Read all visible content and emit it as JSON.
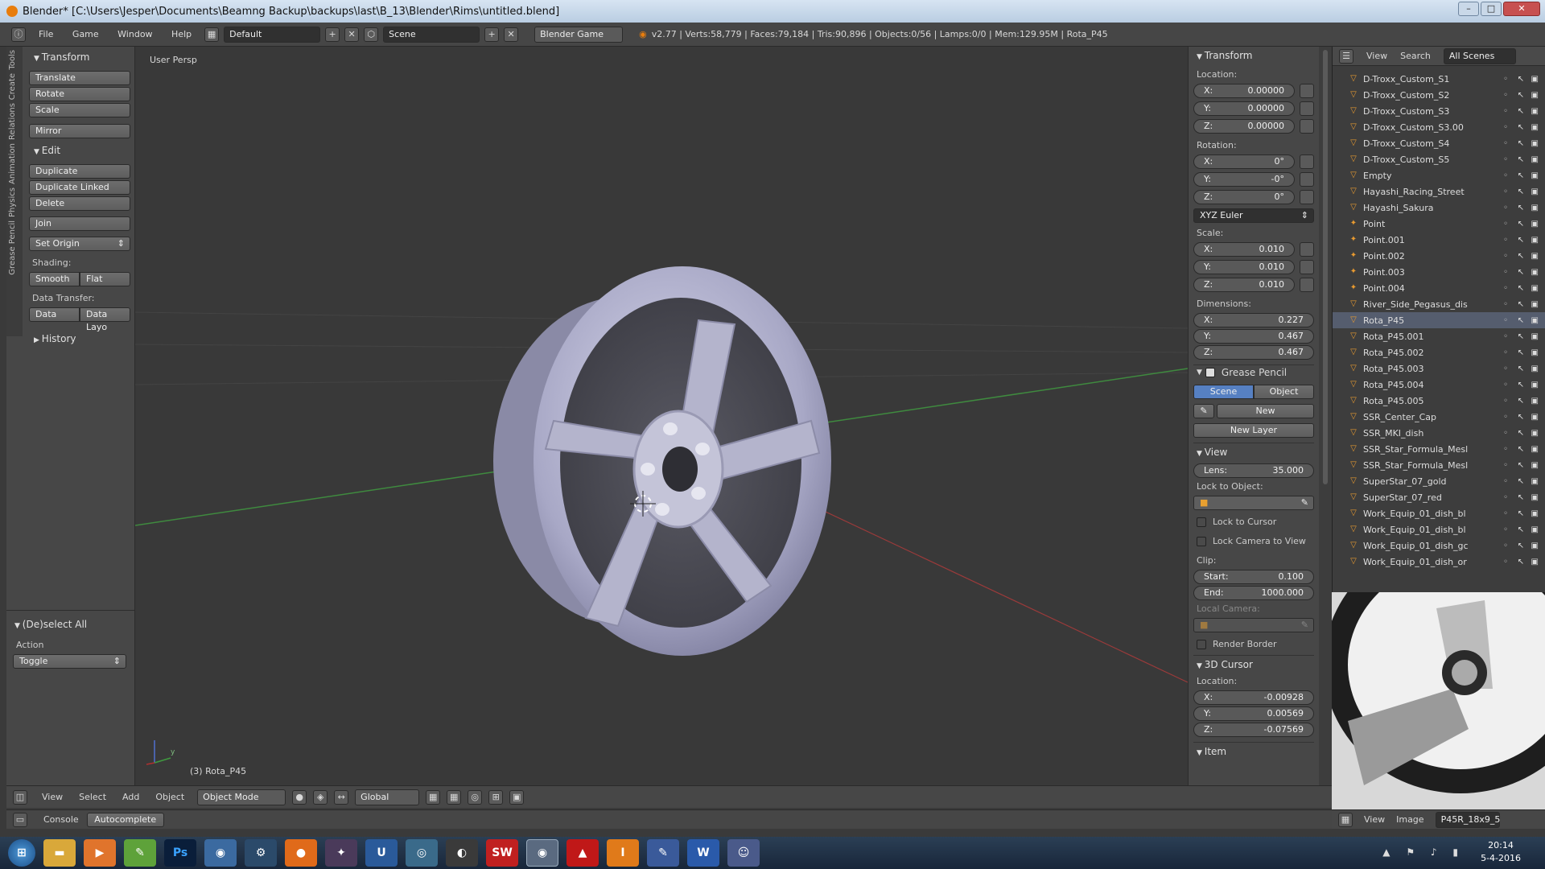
{
  "window": {
    "title": "Blender* [C:\\Users\\Jesper\\Documents\\Beamng Backup\\backups\\last\\B_13\\Blender\\Rims\\untitled.blend]"
  },
  "info_header": {
    "menus": [
      "File",
      "Game",
      "Window",
      "Help"
    ],
    "layout": "Default",
    "scene": "Scene",
    "engine": "Blender Game",
    "stats": "v2.77 | Verts:58,779 | Faces:79,184 | Tris:90,896 | Objects:0/56 | Lamps:0/0 | Mem:129.95M | Rota_P45"
  },
  "tool_shelf": {
    "tabs": [
      "Tools",
      "Create",
      "Relations",
      "Animation",
      "Physics",
      "Grease Pencil"
    ],
    "transform": {
      "title": "Transform",
      "translate": "Translate",
      "rotate": "Rotate",
      "scale": "Scale",
      "mirror": "Mirror"
    },
    "edit": {
      "title": "Edit",
      "duplicate": "Duplicate",
      "duplicate_linked": "Duplicate Linked",
      "delete": "Delete",
      "join": "Join",
      "set_origin": "Set Origin",
      "shading_label": "Shading:",
      "smooth": "Smooth",
      "flat": "Flat",
      "data_transfer_label": "Data Transfer:",
      "data": "Data",
      "data_layout": "Data Layo"
    },
    "history": "History",
    "operator": {
      "title": "(De)select All",
      "action_label": "Action",
      "action_value": "Toggle"
    }
  },
  "viewport": {
    "view_label": "User Persp",
    "object_label": "(3) Rota_P45",
    "axis_y": "y"
  },
  "properties": {
    "transform_title": "Transform",
    "location_label": "Location:",
    "location": [
      {
        "axis": "X:",
        "value": "0.00000"
      },
      {
        "axis": "Y:",
        "value": "0.00000"
      },
      {
        "axis": "Z:",
        "value": "0.00000"
      }
    ],
    "rotation_label": "Rotation:",
    "rotation": [
      {
        "axis": "X:",
        "value": "0°"
      },
      {
        "axis": "Y:",
        "value": "-0°"
      },
      {
        "axis": "Z:",
        "value": "0°"
      }
    ],
    "rotation_mode": "XYZ Euler",
    "scale_label": "Scale:",
    "scale": [
      {
        "axis": "X:",
        "value": "0.010"
      },
      {
        "axis": "Y:",
        "value": "0.010"
      },
      {
        "axis": "Z:",
        "value": "0.010"
      }
    ],
    "dimensions_label": "Dimensions:",
    "dimensions": [
      {
        "axis": "X:",
        "value": "0.227"
      },
      {
        "axis": "Y:",
        "value": "0.467"
      },
      {
        "axis": "Z:",
        "value": "0.467"
      }
    ],
    "grease_pencil": {
      "title": "Grease Pencil",
      "scene": "Scene",
      "object": "Object",
      "new": "New",
      "new_layer": "New Layer"
    },
    "view": {
      "title": "View",
      "lens_label": "Lens:",
      "lens_value": "35.000",
      "lock_to_object": "Lock to Object:",
      "lock_to_cursor": "Lock to Cursor",
      "lock_camera": "Lock Camera to View",
      "clip_label": "Clip:",
      "start_label": "Start:",
      "start_value": "0.100",
      "end_label": "End:",
      "end_value": "1000.000",
      "local_camera": "Local Camera:",
      "render_border": "Render Border"
    },
    "cursor": {
      "title": "3D Cursor",
      "location_label": "Location:",
      "x": "-0.00928",
      "y": "0.00569",
      "z": "-0.07569"
    },
    "item_title": "Item"
  },
  "outliner": {
    "header": {
      "view": "View",
      "search": "Search",
      "filter": "All Scenes"
    },
    "items": [
      {
        "name": "D-Troxx_Custom_S1",
        "icon": "▽"
      },
      {
        "name": "D-Troxx_Custom_S2",
        "icon": "▽"
      },
      {
        "name": "D-Troxx_Custom_S3",
        "icon": "▽"
      },
      {
        "name": "D-Troxx_Custom_S3.00",
        "icon": "▽"
      },
      {
        "name": "D-Troxx_Custom_S4",
        "icon": "▽"
      },
      {
        "name": "D-Troxx_Custom_S5",
        "icon": "▽"
      },
      {
        "name": "Empty",
        "icon": "▽"
      },
      {
        "name": "Hayashi_Racing_Street",
        "icon": "▽"
      },
      {
        "name": "Hayashi_Sakura",
        "icon": "▽"
      },
      {
        "name": "Point",
        "icon": "✦"
      },
      {
        "name": "Point.001",
        "icon": "✦"
      },
      {
        "name": "Point.002",
        "icon": "✦"
      },
      {
        "name": "Point.003",
        "icon": "✦"
      },
      {
        "name": "Point.004",
        "icon": "✦"
      },
      {
        "name": "River_Side_Pegasus_dis",
        "icon": "▽"
      },
      {
        "name": "Rota_P45",
        "icon": "▽"
      },
      {
        "name": "Rota_P45.001",
        "icon": "▽"
      },
      {
        "name": "Rota_P45.002",
        "icon": "▽"
      },
      {
        "name": "Rota_P45.003",
        "icon": "▽"
      },
      {
        "name": "Rota_P45.004",
        "icon": "▽"
      },
      {
        "name": "Rota_P45.005",
        "icon": "▽"
      },
      {
        "name": "SSR_Center_Cap",
        "icon": "▽"
      },
      {
        "name": "SSR_MKI_dish",
        "icon": "▽"
      },
      {
        "name": "SSR_Star_Formula_Mesl",
        "icon": "▽"
      },
      {
        "name": "SSR_Star_Formula_Mesl",
        "icon": "▽"
      },
      {
        "name": "SuperStar_07_gold",
        "icon": "▽"
      },
      {
        "name": "SuperStar_07_red",
        "icon": "▽"
      },
      {
        "name": "Work_Equip_01_dish_bl",
        "icon": "▽"
      },
      {
        "name": "Work_Equip_01_dish_bl",
        "icon": "▽"
      },
      {
        "name": "Work_Equip_01_dish_gc",
        "icon": "▽"
      },
      {
        "name": "Work_Equip_01_dish_or",
        "icon": "▽"
      }
    ]
  },
  "image_editor": {
    "view": "View",
    "image": "Image",
    "image_name": "P45R_18x9_5"
  },
  "viewport_header": {
    "view": "View",
    "select": "Select",
    "add": "Add",
    "object": "Object",
    "mode": "Object Mode",
    "orientation": "Global"
  },
  "console_bar": {
    "console": "Console",
    "autocomplete": "Autocomplete"
  },
  "taskbar": {
    "time": "20:14",
    "date": "5-4-2016",
    "apps": [
      "win-start-icon",
      "explorer-icon",
      "media-icon",
      "notepad-icon",
      "photoshop-icon",
      "chrome-icon",
      "steam-icon",
      "origin-icon",
      "game-icon",
      "uplay-icon",
      "eye-icon",
      "obs-icon",
      "solidworks-icon",
      "blender-icon",
      "autocad-icon",
      "inventor-icon",
      "paint-icon",
      "word-icon",
      "discord-icon"
    ],
    "app_labels": {
      "ps": "Ps",
      "sw": "SW",
      "w": "W"
    }
  }
}
